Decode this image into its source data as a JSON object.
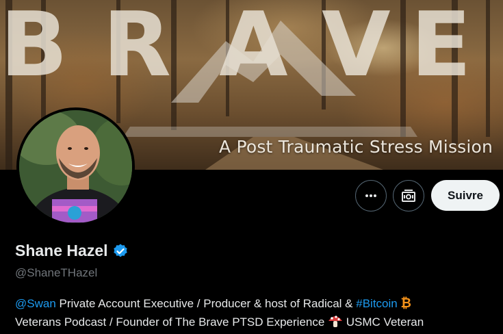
{
  "banner": {
    "word": "BRAVE",
    "tagline": "A Post Traumatic Stress Mission"
  },
  "profile": {
    "display_name": "Shane Hazel",
    "handle": "@ShaneTHazel",
    "verified": true
  },
  "actions": {
    "more_icon": "more-dots-icon",
    "subscribe_icon": "subscribe-icon",
    "follow_label": "Suivre"
  },
  "bio": {
    "mention": "@Swan",
    "text1": " Private Account Executive / Producer & host of Radical & ",
    "hashtag": "#Bitcoin",
    "btc_symbol": "₿",
    "text2": "Veterans Podcast / Founder of The Brave PTSD Experience ",
    "text3": " USMC Veteran"
  },
  "colors": {
    "link": "#1d9bf0",
    "follow_bg": "#eff3f4",
    "verified": "#1d9bf0",
    "bitcoin": "#f7931a"
  }
}
